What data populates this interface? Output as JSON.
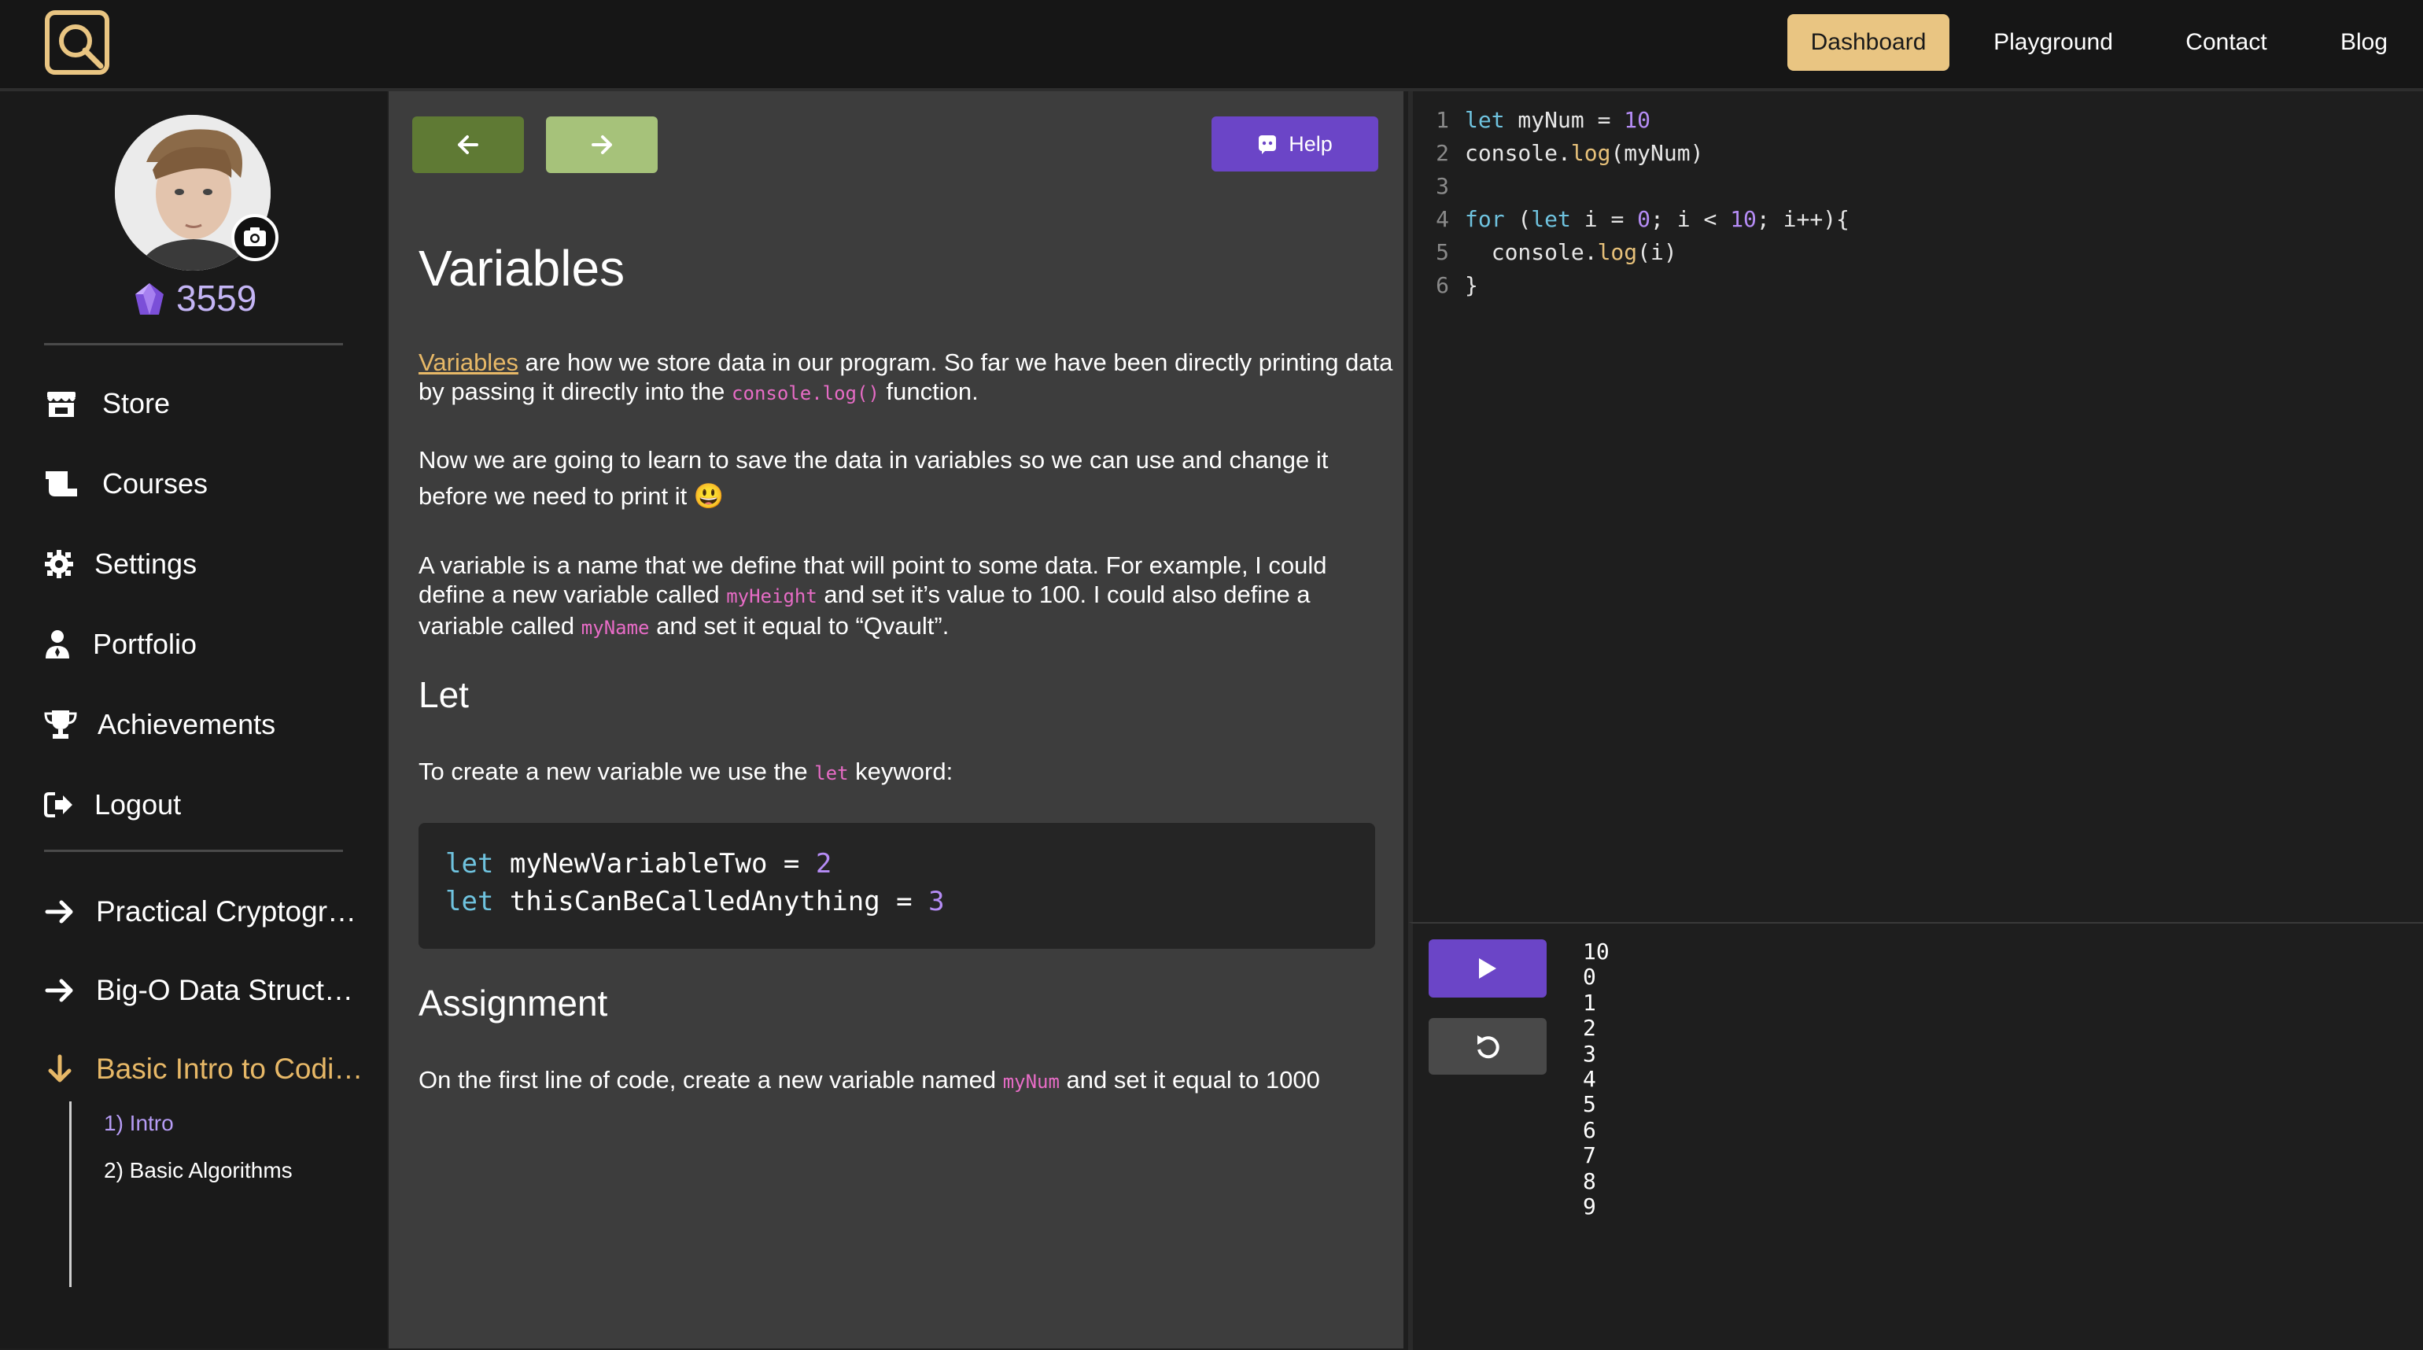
{
  "nav": {
    "dashboard": "Dashboard",
    "playground": "Playground",
    "contact": "Contact",
    "blog": "Blog"
  },
  "user": {
    "points": "3559"
  },
  "sidebar": {
    "items": [
      {
        "label": "Store",
        "icon": "store-icon"
      },
      {
        "label": "Courses",
        "icon": "courses-icon"
      },
      {
        "label": "Settings",
        "icon": "gear-icon"
      },
      {
        "label": "Portfolio",
        "icon": "user-tie-icon"
      },
      {
        "label": "Achievements",
        "icon": "trophy-icon"
      },
      {
        "label": "Logout",
        "icon": "logout-icon"
      }
    ],
    "courses": [
      {
        "label": "Practical Cryptography",
        "icon": "arrow-right-icon"
      },
      {
        "label": "Big-O Data Structures",
        "icon": "arrow-right-icon"
      },
      {
        "label": "Basic Intro to Coding",
        "icon": "arrow-down-icon",
        "active": true
      }
    ],
    "sub_items": [
      {
        "label": "1) Intro",
        "active": true
      },
      {
        "label": "2) Basic Algorithms",
        "active": false
      }
    ]
  },
  "lesson": {
    "help_label": "Help",
    "title": "Variables",
    "p1_link": "Variables",
    "p1_text1": " are how we store data in our program. So far we have been directly printing data by passing it directly into the ",
    "p1_code": "console.log()",
    "p1_text2": " function.",
    "p2": "Now we are going to learn to save the data in variables so we can use and change it before we need to print it 😃",
    "p3_text1": "A variable is a name that we define that will point to some data. For example, I could define a new variable called ",
    "p3_code1": "myHeight",
    "p3_text2": " and set it’s value to 100. I could also define a variable called ",
    "p3_code2": "myName",
    "p3_text3": " and set it equal to “Qvault”.",
    "let_heading": "Let",
    "p4_text1": "To create a new variable we use the ",
    "p4_code": "let",
    "p4_text2": " keyword:",
    "code_block": [
      {
        "kw": "let",
        "rest": " myNewVariableTwo = ",
        "num": "2"
      },
      {
        "kw": "let",
        "rest": " thisCanBeCalledAnything = ",
        "num": "3"
      }
    ],
    "assignment_heading": "Assignment",
    "p5_text1": "On the first line of code, create a new variable named ",
    "p5_code": "myNum",
    "p5_text2": " and set it equal to 1000"
  },
  "editor": {
    "lines": [
      {
        "n": "1",
        "text": "let myNum = 10"
      },
      {
        "n": "2",
        "text": "console.log(myNum)"
      },
      {
        "n": "3",
        "text": ""
      },
      {
        "n": "4",
        "text": "for (let i = 0; i < 10; i++){"
      },
      {
        "n": "5",
        "text": "  console.log(i)"
      },
      {
        "n": "6",
        "text": "}"
      }
    ]
  },
  "console": {
    "output": [
      "10",
      "0",
      "1",
      "2",
      "3",
      "4",
      "5",
      "6",
      "7",
      "8",
      "9"
    ]
  },
  "colors": {
    "accent": "#e9c582",
    "purple": "#6b45c7",
    "link": "#e7b867",
    "code_pink": "#e76cc6"
  }
}
